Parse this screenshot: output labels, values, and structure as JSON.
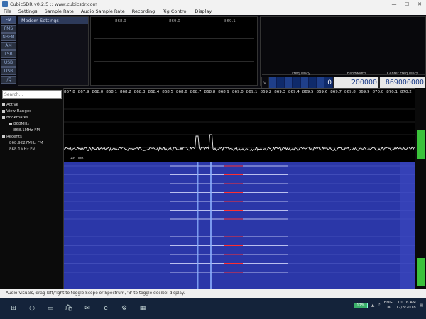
{
  "window": {
    "title": "CubicSDR v0.2.5 :: www.cubicsdr.com",
    "minimize": "—",
    "maximize": "☐",
    "close": "✕"
  },
  "menu": [
    "File",
    "Settings",
    "Sample Rate",
    "Audio Sample Rate",
    "Recording",
    "Rig Control",
    "Display"
  ],
  "modes": [
    "FM",
    "FMS",
    "NBFM",
    "AM",
    "LSB",
    "USB",
    "DSB",
    "I/Q"
  ],
  "modem_panel": {
    "title": "Modem Settings"
  },
  "audio_scope": {
    "ticks": [
      "868.9",
      "869.0",
      "869.1"
    ]
  },
  "freq_controls": {
    "v_label": "V",
    "frequency": {
      "label": "Frequency",
      "value": "0"
    },
    "bandwidth": {
      "label": "Bandwidth",
      "value": "200000"
    },
    "center": {
      "label": "Center Frequency",
      "value": "869000000"
    }
  },
  "sidebar": {
    "search_placeholder": "Search...",
    "tree": [
      {
        "label": "Active",
        "level": 0
      },
      {
        "label": "View Ranges",
        "level": 0
      },
      {
        "label": "Bookmarks",
        "level": 0
      },
      {
        "label": "868MHz",
        "level": 1
      },
      {
        "label": "868.1MHz FM",
        "level": 2
      },
      {
        "label": "Recents",
        "level": 0
      },
      {
        "label": "868.9227MHz FM",
        "level": 1
      },
      {
        "label": "868.1MHz FM",
        "level": 1
      }
    ]
  },
  "spectrum": {
    "ticks": [
      "867.8",
      "867.9",
      "868.0",
      "868.1",
      "868.2",
      "868.3",
      "868.4",
      "868.5",
      "868.6",
      "868.7",
      "868.8",
      "868.9",
      "869.0",
      "869.1",
      "869.2",
      "869.3",
      "869.4",
      "869.5",
      "869.6",
      "869.7",
      "869.8",
      "869.9",
      "870.0",
      "870.1",
      "870.2"
    ],
    "db_label": "-46.0dB"
  },
  "status_text": "Audio Visuals, drag left/right to toggle Scope or Spectrum, 'B' to toggle decibel display.",
  "taskbar": {
    "icons": [
      {
        "name": "windows-start-icon",
        "glyph": "⊞"
      },
      {
        "name": "search-icon",
        "glyph": "○"
      },
      {
        "name": "task-view-icon",
        "glyph": "▭"
      },
      {
        "name": "store-icon",
        "glyph": "🛍"
      },
      {
        "name": "mail-icon",
        "glyph": "✉"
      },
      {
        "name": "edge-icon",
        "glyph": "e"
      },
      {
        "name": "settings-icon",
        "glyph": "⚙"
      },
      {
        "name": "cubicsdr-icon",
        "glyph": "▦"
      }
    ],
    "battery": "12%",
    "lang_top": "ENG",
    "lang_bottom": "UK",
    "time": "10:16 AM",
    "date": "12/8/2018"
  },
  "colors": {
    "waterfall_bg": "#2b37a8",
    "signal_red": "#ff3030",
    "meter_green": "#3bc23b"
  }
}
